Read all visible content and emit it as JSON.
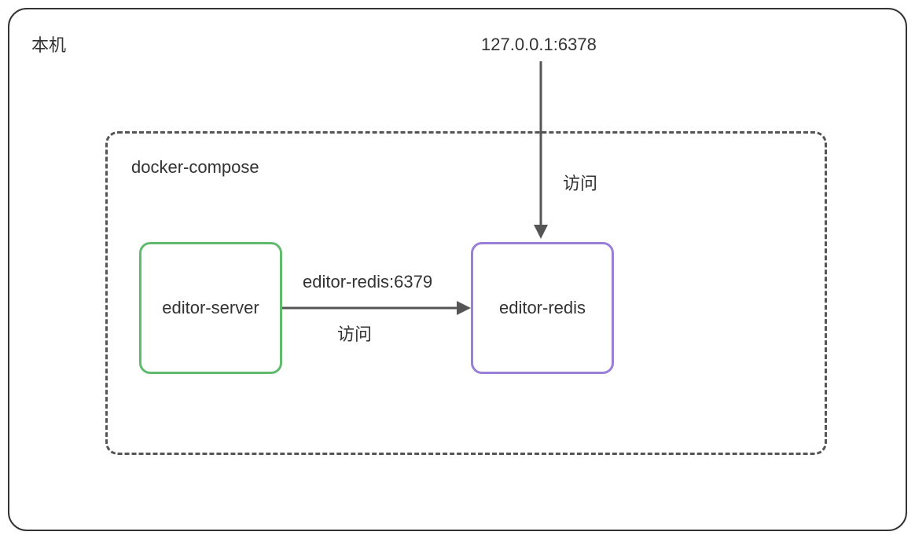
{
  "diagram": {
    "outer_label": "本机",
    "inner_label": "docker-compose",
    "top_address": "127.0.0.1:6378",
    "nodes": {
      "server": "editor-server",
      "redis": "editor-redis"
    },
    "edges": {
      "top_to_redis": {
        "label": "访问"
      },
      "server_to_redis": {
        "label_top": "editor-redis:6379",
        "label_bottom": "访问"
      }
    }
  }
}
